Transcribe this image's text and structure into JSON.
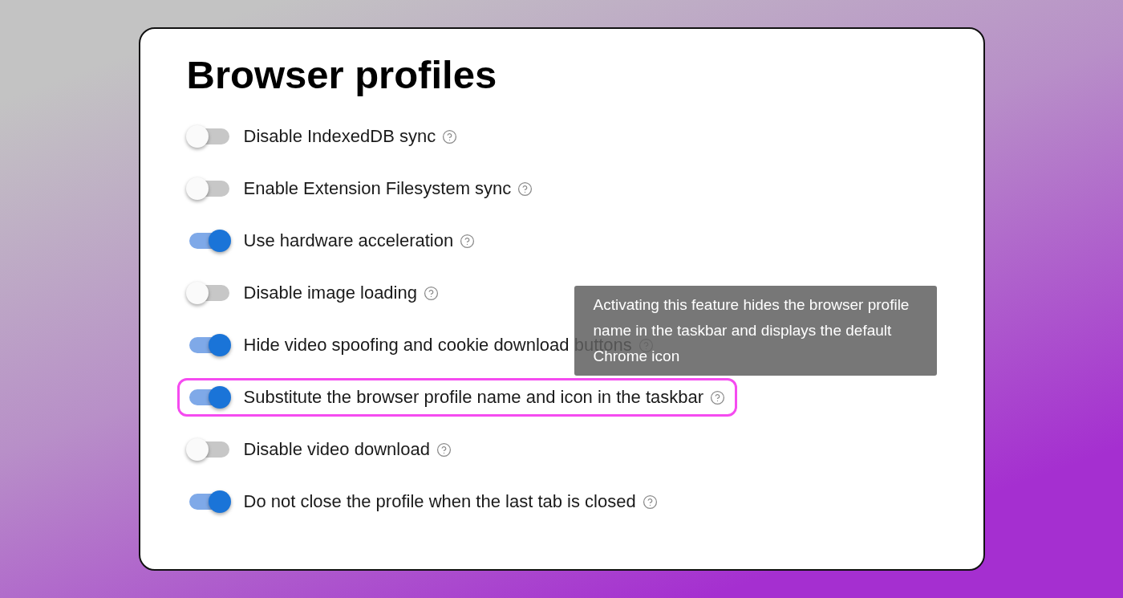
{
  "title": "Browser profiles",
  "settings": [
    {
      "label": "Disable IndexedDB sync",
      "on": false,
      "highlighted": false
    },
    {
      "label": "Enable Extension Filesystem sync",
      "on": false,
      "highlighted": false
    },
    {
      "label": "Use hardware acceleration",
      "on": true,
      "highlighted": false
    },
    {
      "label": "Disable image loading",
      "on": false,
      "highlighted": false
    },
    {
      "label": "Hide video spoofing and cookie download buttons",
      "on": true,
      "highlighted": false
    },
    {
      "label": "Substitute the browser profile name and icon in the taskbar",
      "on": true,
      "highlighted": true
    },
    {
      "label": "Disable video download",
      "on": false,
      "highlighted": false
    },
    {
      "label": "Do not close the profile when the last tab is closed",
      "on": true,
      "highlighted": false
    }
  ],
  "tooltip": {
    "text": "Activating this feature hides the browser profile name in the taskbar and displays the default Chrome icon"
  }
}
